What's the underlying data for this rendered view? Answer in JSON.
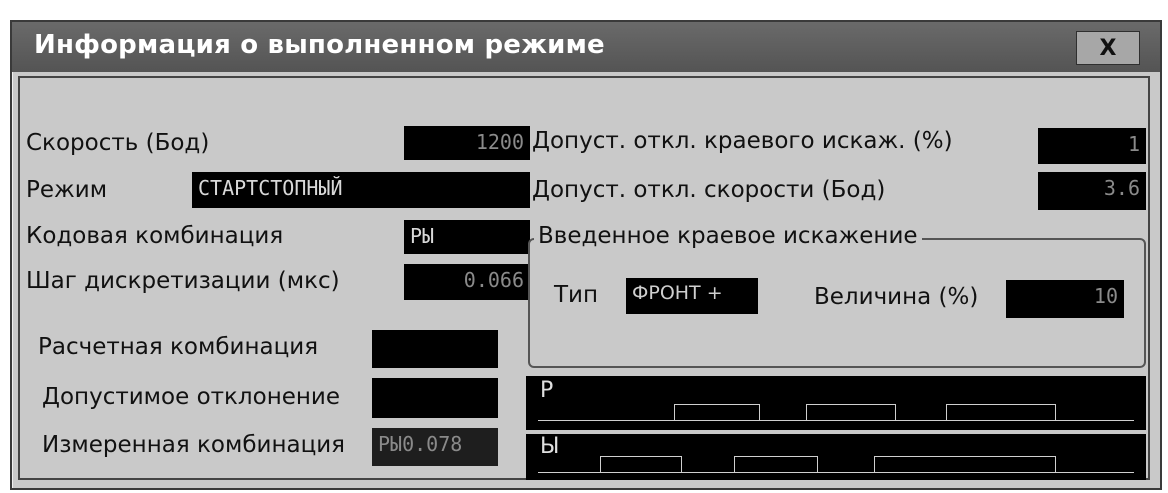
{
  "window": {
    "title": "Информация о выполненном режиме",
    "close_label": "X"
  },
  "fields": {
    "speed_label": "Скорость (Бод)",
    "speed_value": "1200",
    "mode_label": "Режим",
    "mode_value": "СТАРТСТОПНЫЙ",
    "code_label": "Кодовая комбинация",
    "code_value": "РЫ",
    "step_label": "Шаг дискретизации (мкс)",
    "step_value": "0.066",
    "calc_label": "Расчетная комбинация",
    "calc_value": "",
    "dev_label": "Допустимое отклонение",
    "dev_value": "",
    "measured_label": "Измеренная комбинация",
    "measured_value": "РЫ0.078"
  },
  "tolerances": {
    "edge_label": "Допуст. откл. краевого искаж. (%)",
    "edge_value": "1",
    "speed_label": "Допуст. откл. скорости (Бод)",
    "speed_value": "3.6"
  },
  "distortion": {
    "group_title": "Введенное краевое искажение",
    "type_label": "Тип",
    "type_value": "ФРОНТ +",
    "amount_label": "Величина (%)",
    "amount_value": "10"
  },
  "scopes": {
    "top_label": "Р",
    "bottom_label": "Ы"
  },
  "colors": {
    "window_bg": "#c9c9c9",
    "titlebar": "#5e5e5e",
    "lcd_bg": "#000000"
  }
}
